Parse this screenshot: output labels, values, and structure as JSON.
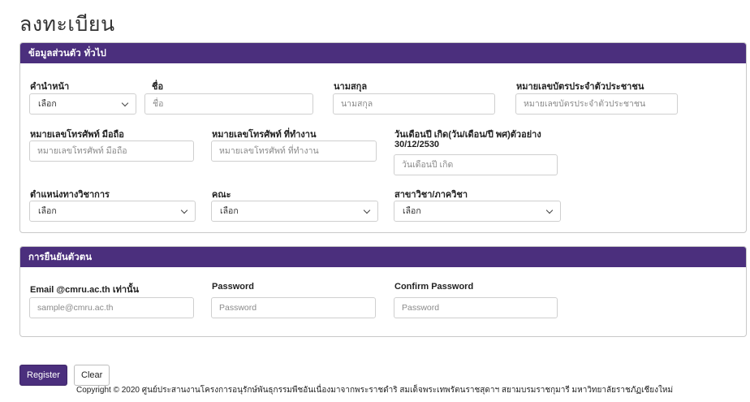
{
  "page": {
    "title": "ลงทะเบียน"
  },
  "personal": {
    "header": "ข้อมูลส่วนตัว ทั่วไป",
    "prefix": {
      "label": "คำนำหน้า",
      "value": "เลือก"
    },
    "firstname": {
      "label": "ชื่อ",
      "placeholder": "ชื่อ"
    },
    "lastname": {
      "label": "นามสกุล",
      "placeholder": "นามสกุล"
    },
    "idcard": {
      "label": "หมายเลขบัตรประจำตัวประชาชน",
      "placeholder": "หมายเลขบัตรประจำตัวประชาชน"
    },
    "mobile": {
      "label": "หมายเลขโทรศัพท์ มือถือ",
      "placeholder": "หมายเลขโทรศัพท์ มือถือ"
    },
    "workphone": {
      "label": "หมายเลขโทรศัพท์ ที่ทำงาน",
      "placeholder": "หมายเลขโทรศัพท์ ที่ทำงาน"
    },
    "birthdate": {
      "label_line1": "วันเดือนปี เกิด(วัน/เดือน/ปี พศ)ตัวอย่าง",
      "label_line2": "30/12/2530",
      "placeholder": "วันเดือนปี เกิด"
    },
    "position": {
      "label": "ตำแหน่งทางวิชาการ",
      "value": "เลือก"
    },
    "faculty": {
      "label": "คณะ",
      "value": "เลือก"
    },
    "department": {
      "label": "สาขาวิชา/ภาควิชา",
      "value": "เลือก"
    }
  },
  "auth": {
    "header": "การยืนยันตัวตน",
    "email": {
      "label": "Email @cmru.ac.th เท่านั้น",
      "placeholder": "sample@cmru.ac.th"
    },
    "password": {
      "label": "Password",
      "placeholder": "Password"
    },
    "confirm": {
      "label": "Confirm Password",
      "placeholder": "Password"
    }
  },
  "actions": {
    "register": "Register",
    "clear": "Clear"
  },
  "footer": {
    "copyright": "Copyright © 2020 ศูนย์ประสานงานโครงการอนุรักษ์พันธุกรรมพืชอันเนื่องมาจากพระราชดำริ สมเด็จพระเทพรัตนราชสุดาฯ สยามบรมราชกุมารี มหาวิทยาลัยราชภัฏเชียงใหม่"
  }
}
